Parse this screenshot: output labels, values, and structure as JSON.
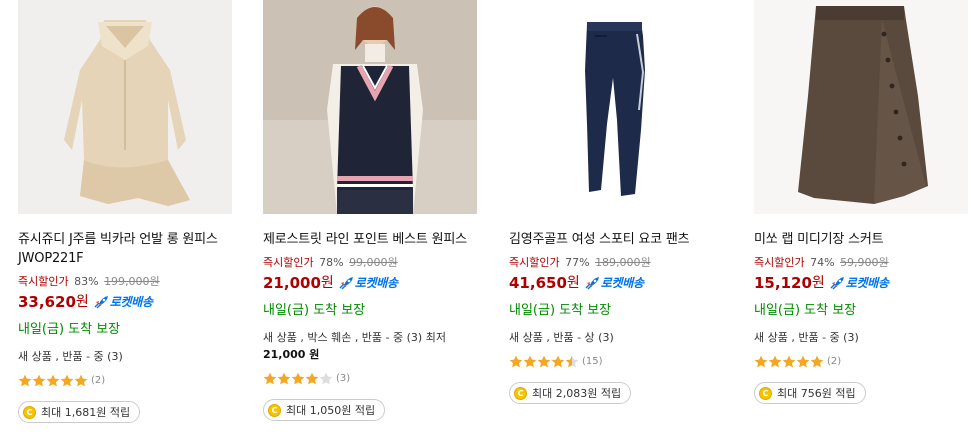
{
  "colors": {
    "price": "#ae0000",
    "discount_label": "#ae0000",
    "rocket": "#0074e9",
    "arrival": "#008c00",
    "star": "#f5a623",
    "coin": "#f7c500"
  },
  "products": [
    {
      "image_icon": "dress-photo",
      "name": "쥬시쥬디 J주름 빅카라 언발 롱 원피스 JWOP221F",
      "discount_label": "즉시할인가",
      "discount_rate": "83%",
      "base_price": "199,000원",
      "price": "33,620",
      "price_unit": "원",
      "rocket_label": "로켓배송",
      "arrival": "내일(금) 도착 보장",
      "condition_text": "새 상품 , 반품 - 중 (3)",
      "condition_extra": "",
      "rating": 5,
      "review_count": "(2)",
      "reward_coin": "C",
      "reward_text": "최대 1,681원 적립"
    },
    {
      "image_icon": "vest-photo",
      "name": "제로스트릿 라인 포인트 베스트 원피스",
      "discount_label": "즉시할인가",
      "discount_rate": "78%",
      "base_price": "99,000원",
      "price": "21,000",
      "price_unit": "원",
      "rocket_label": "로켓배송",
      "arrival": "내일(금) 도착 보장",
      "condition_text": "새 상품 , 박스 훼손 , 반품 - 중 (3) 최저 ",
      "condition_extra": "21,000 원",
      "rating": 4,
      "review_count": "(3)",
      "reward_coin": "C",
      "reward_text": "최대 1,050원 적립"
    },
    {
      "image_icon": "pants-photo",
      "name": "김영주골프 여성 스포티 요코 팬츠",
      "discount_label": "즉시할인가",
      "discount_rate": "77%",
      "base_price": "189,000원",
      "price": "41,650",
      "price_unit": "원",
      "rocket_label": "로켓배송",
      "arrival": "내일(금) 도착 보장",
      "condition_text": "새 상품 , 반품 - 상 (3)",
      "condition_extra": "",
      "rating": 4.5,
      "review_count": "(15)",
      "reward_coin": "C",
      "reward_text": "최대 2,083원 적립"
    },
    {
      "image_icon": "skirt-photo",
      "name": "미쏘 랩 미디기장 스커트",
      "discount_label": "즉시할인가",
      "discount_rate": "74%",
      "base_price": "59,900원",
      "price": "15,120",
      "price_unit": "원",
      "rocket_label": "로켓배송",
      "arrival": "내일(금) 도착 보장",
      "condition_text": "새 상품 , 반품 - 중 (3)",
      "condition_extra": "",
      "rating": 5,
      "review_count": "(2)",
      "reward_coin": "C",
      "reward_text": "최대 756원 적립"
    }
  ]
}
